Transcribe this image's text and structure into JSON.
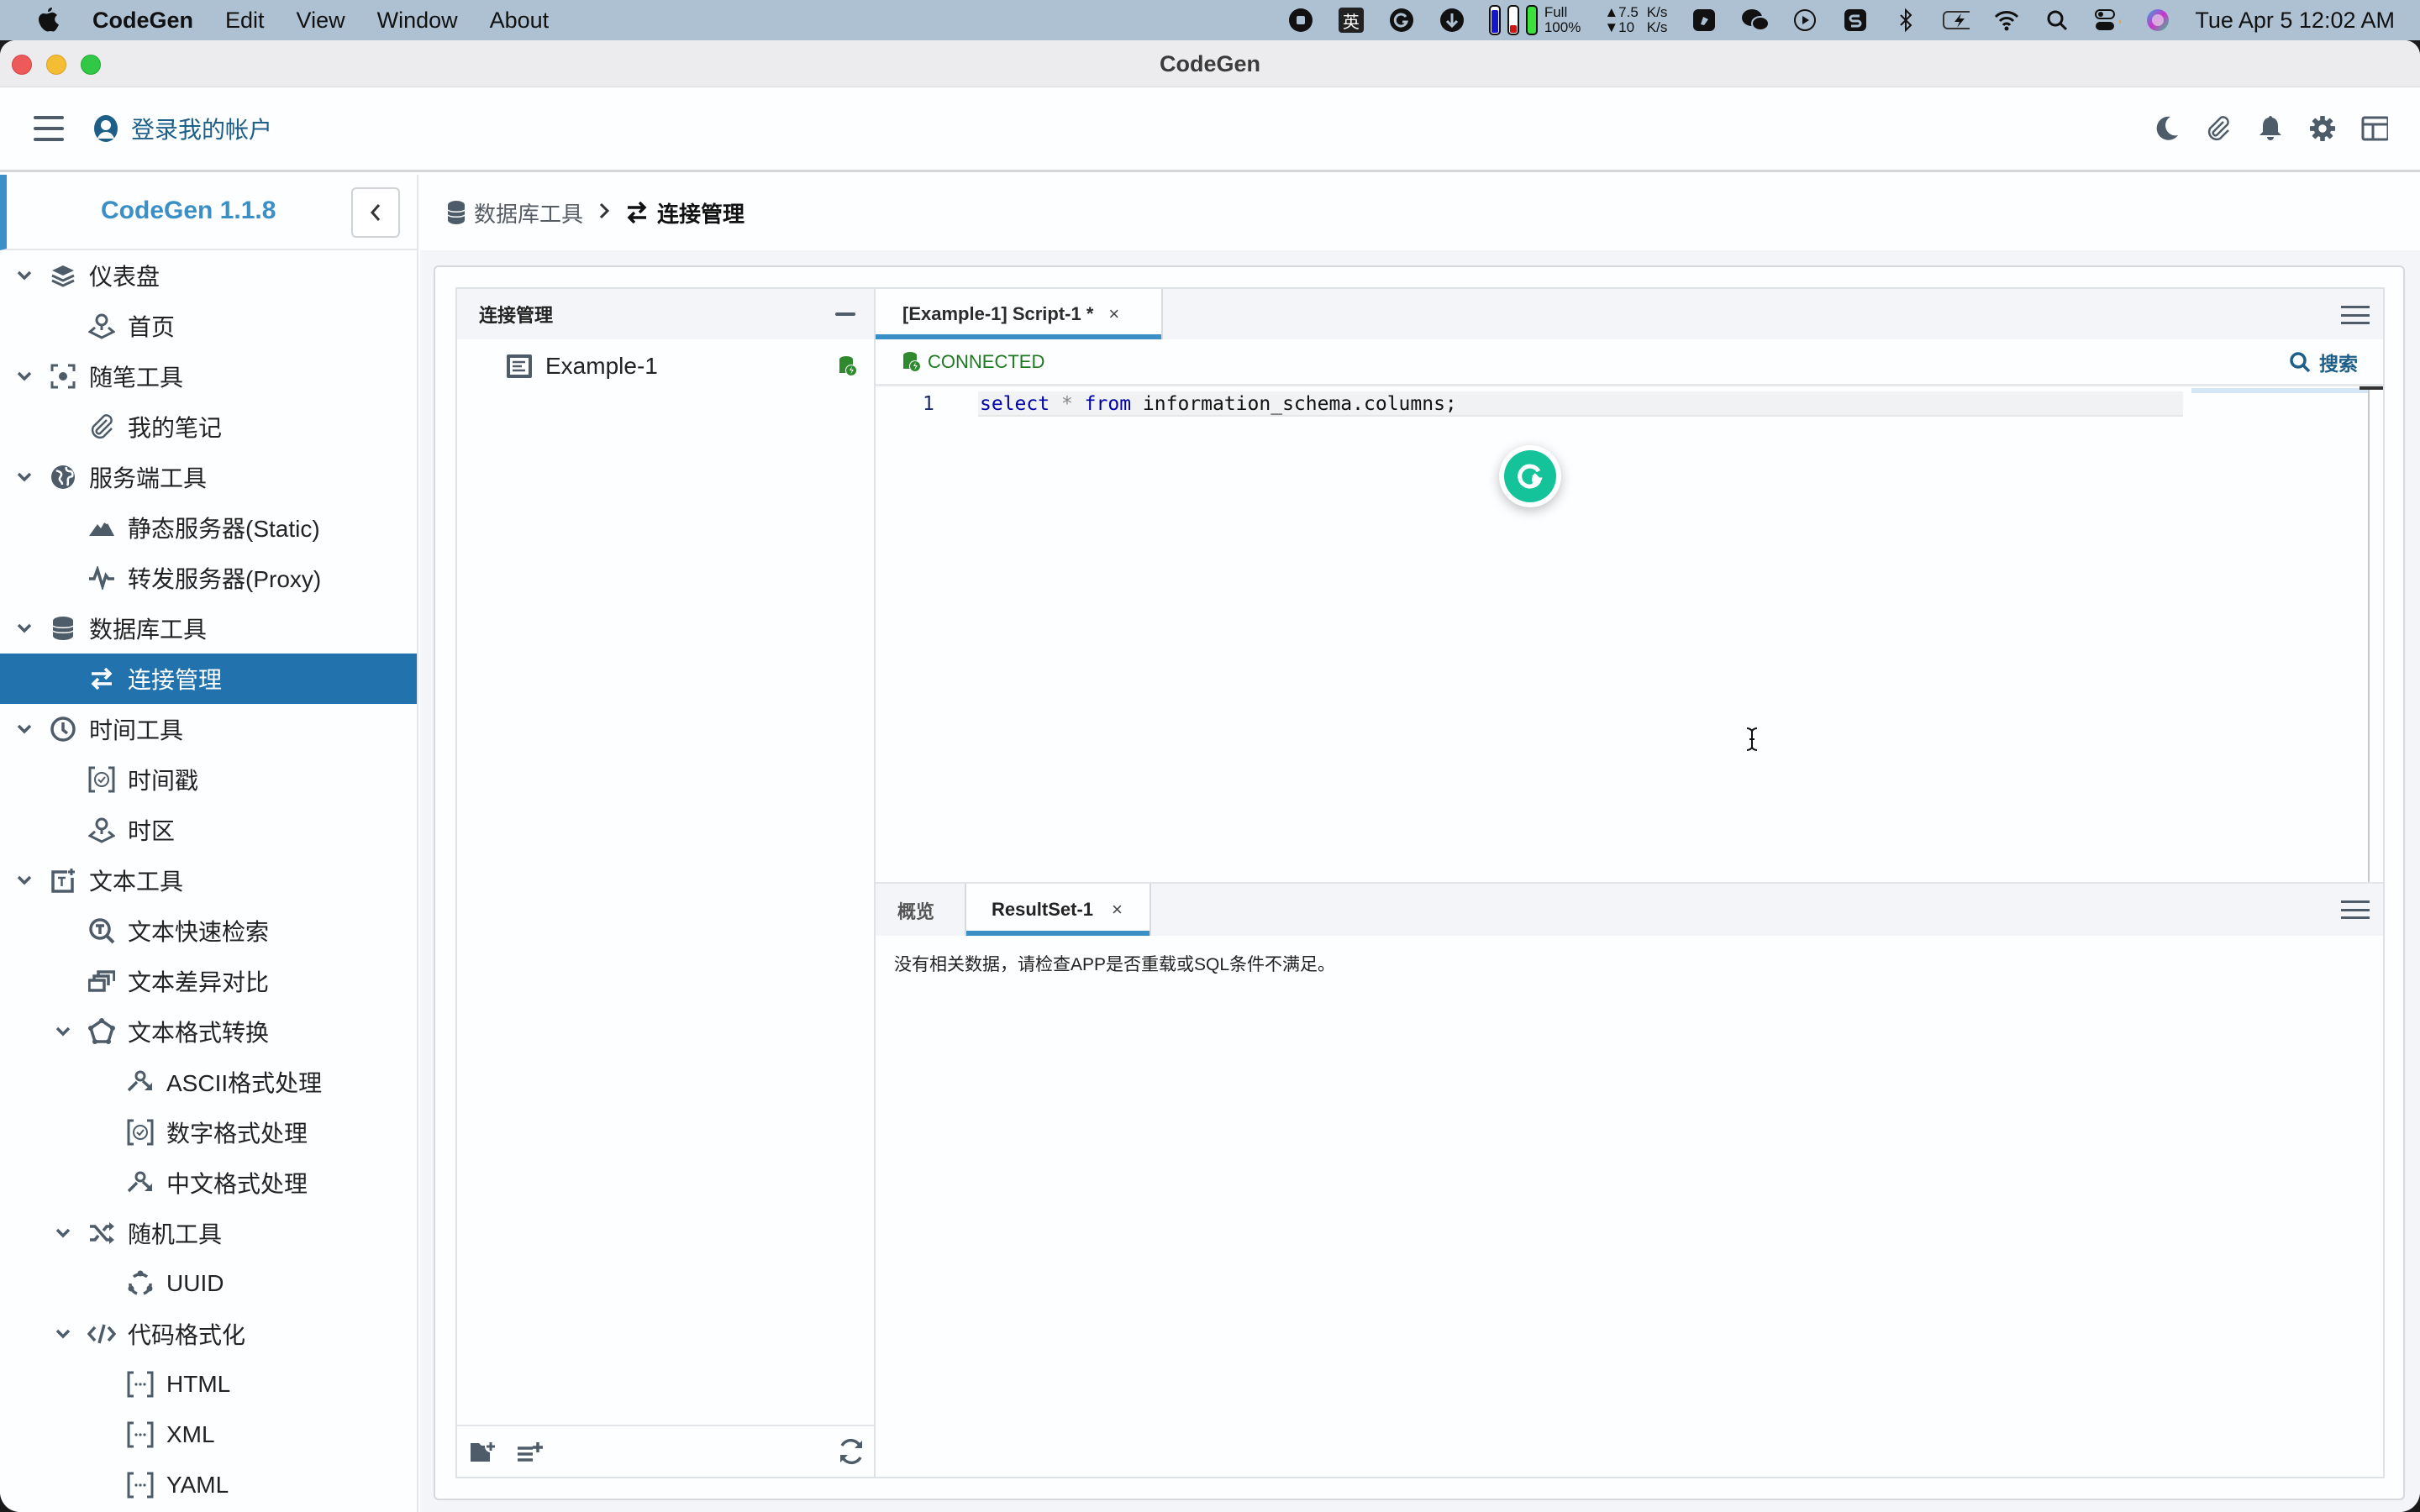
{
  "menubar": {
    "app_name": "CodeGen",
    "menus": [
      "Edit",
      "View",
      "Window",
      "About"
    ],
    "status": {
      "battery_label_top": "Full",
      "battery_label_bottom": "100%",
      "net_up": "▲7.5",
      "net_down": "▼10",
      "net_unit_up": "K/s",
      "net_unit_down": "K/s",
      "input_method": "英",
      "clock": "Tue Apr 5  12:02 AM"
    }
  },
  "window": {
    "title": "CodeGen"
  },
  "header": {
    "login_label": "登录我的帐户",
    "tools": [
      "moon-icon",
      "paperclip-icon",
      "bell-icon",
      "gear-icon",
      "layout-icon"
    ]
  },
  "sidebar": {
    "brand": "CodeGen 1.1.8",
    "items": [
      {
        "label": "仪表盘",
        "level": 0,
        "icon": "layers-icon",
        "expanded": true
      },
      {
        "label": "首页",
        "level": 1,
        "icon": "map-pin-icon"
      },
      {
        "label": "随笔工具",
        "level": 0,
        "icon": "focus-icon",
        "expanded": true
      },
      {
        "label": "我的笔记",
        "level": 1,
        "icon": "paperclip-icon"
      },
      {
        "label": "服务端工具",
        "level": 0,
        "icon": "globe-icon",
        "expanded": true
      },
      {
        "label": "静态服务器(Static)",
        "level": 1,
        "icon": "mountain-icon"
      },
      {
        "label": "转发服务器(Proxy)",
        "level": 1,
        "icon": "pulse-icon"
      },
      {
        "label": "数据库工具",
        "level": 0,
        "icon": "database-icon",
        "expanded": true
      },
      {
        "label": "连接管理",
        "level": 1,
        "icon": "swap-icon",
        "active": true
      },
      {
        "label": "时间工具",
        "level": 0,
        "icon": "clock-icon",
        "expanded": true
      },
      {
        "label": "时间戳",
        "level": 1,
        "icon": "timer-icon"
      },
      {
        "label": "时区",
        "level": 1,
        "icon": "map-pin-icon"
      },
      {
        "label": "文本工具",
        "level": 0,
        "icon": "text-add-icon",
        "expanded": true
      },
      {
        "label": "文本快速检索",
        "level": 1,
        "icon": "text-search-icon"
      },
      {
        "label": "文本差异对比",
        "level": 1,
        "icon": "compare-icon"
      },
      {
        "label": "文本格式转换",
        "level": 1,
        "icon": "polygon-icon",
        "expanded": true
      },
      {
        "label": "ASCII格式处理",
        "level": 2,
        "icon": "route-icon"
      },
      {
        "label": "数字格式处理",
        "level": 2,
        "icon": "timer-icon"
      },
      {
        "label": "中文格式处理",
        "level": 2,
        "icon": "route-icon"
      },
      {
        "label": "随机工具",
        "level": 1,
        "icon": "shuffle-icon",
        "expanded": true
      },
      {
        "label": "UUID",
        "level": 2,
        "icon": "cycle-icon"
      },
      {
        "label": "代码格式化",
        "level": 1,
        "icon": "code-icon",
        "expanded": true
      },
      {
        "label": "HTML",
        "level": 2,
        "icon": "brackets-icon"
      },
      {
        "label": "XML",
        "level": 2,
        "icon": "brackets-icon"
      },
      {
        "label": "YAML",
        "level": 2,
        "icon": "brackets-icon"
      }
    ]
  },
  "breadcrumb": {
    "parent": "数据库工具",
    "current": "连接管理"
  },
  "connections": {
    "title": "连接管理",
    "items": [
      {
        "name": "Example-1",
        "status": "connected"
      }
    ]
  },
  "editor": {
    "tab_label": "[Example-1] Script-1 *",
    "tab_close": "×",
    "status": "CONNECTED",
    "search_label": "搜索",
    "lines": [
      {
        "number": "1",
        "tokens": [
          {
            "text": "select",
            "type": "kw"
          },
          {
            "text": " ",
            "type": "plain"
          },
          {
            "text": "*",
            "type": "op"
          },
          {
            "text": " ",
            "type": "plain"
          },
          {
            "text": "from",
            "type": "kw"
          },
          {
            "text": " information_schema.columns;",
            "type": "plain"
          }
        ]
      }
    ]
  },
  "results": {
    "tabs": [
      "概览",
      "ResultSet-1"
    ],
    "active_tab": "ResultSet-1",
    "tab_close": "×",
    "empty_message": "没有相关数据，请检查APP是否重载或SQL条件不满足。"
  },
  "colors": {
    "accent": "#3a8fc6",
    "active_nav": "#2272ae",
    "connected": "#1e7a21",
    "link": "#1e5f8a",
    "icon": "#4e5c69"
  }
}
